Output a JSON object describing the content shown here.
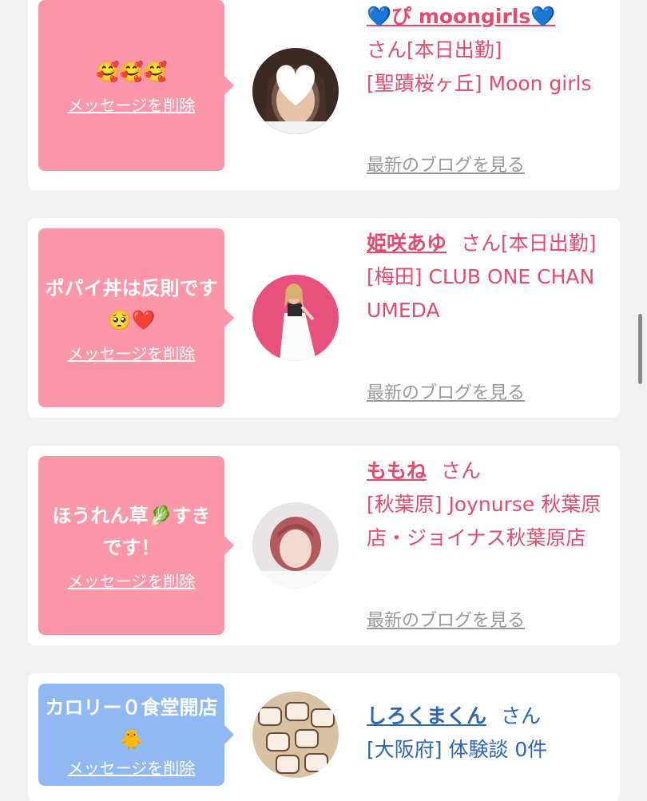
{
  "cards": [
    {
      "message": "🥰🥰🥰",
      "delete_label": "メッセージを削除",
      "name": "💙ぴ moongirls💙",
      "suffix": "さん[本日出勤]",
      "shop": "[聖蹟桜ヶ丘] Moon girls",
      "blog_label": "最新のブログを見る",
      "bubble_color": "#fb97a8",
      "text_color": "#e64a6d"
    },
    {
      "message": "ポパイ丼は反則です🥺❤️",
      "delete_label": "メッセージを削除",
      "name": "姫咲あゆ",
      "suffix": "さん[本日出勤]",
      "shop": "[梅田] CLUB ONE CHAN UMEDA",
      "blog_label": "最新のブログを見る",
      "bubble_color": "#fb97a8",
      "text_color": "#e64a6d"
    },
    {
      "message": "ほうれん草🥬すきです！",
      "delete_label": "メッセージを削除",
      "name": "ももね",
      "suffix": "さん",
      "shop": "[秋葉原] Joynurse 秋葉原店・ジョイナス秋葉原店",
      "blog_label": "最新のブログを見る",
      "bubble_color": "#fb97a8",
      "text_color": "#e64a6d"
    },
    {
      "message": "カロリー０食堂開店🐥",
      "delete_label": "メッセージを削除",
      "name": "しろくまくん",
      "suffix": "さん",
      "shop": "[大阪府] 体験談 0件",
      "bubble_color": "#90b9f3",
      "text_color": "#2e66b5"
    }
  ]
}
